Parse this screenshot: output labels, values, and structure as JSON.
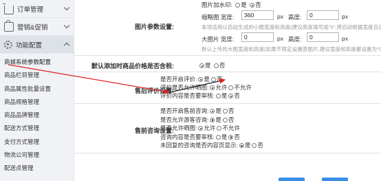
{
  "sidebar": {
    "sections": [
      {
        "label": "订单管理",
        "icon": "cart-icon",
        "state": "collapsed"
      },
      {
        "label": "营销&促销",
        "icon": "shop-icon",
        "state": "collapsed"
      },
      {
        "label": "功能配置",
        "icon": "gear-icon",
        "state": "expanded"
      }
    ],
    "items": [
      "商城系统参数配置",
      "商品栏目管理",
      "商品属性批量设置",
      "商品规格管理",
      "商品品牌管理",
      "配送方式管理",
      "支付方式管理",
      "物流公司管理",
      "配送点管理"
    ]
  },
  "settings": {
    "image_params": {
      "label": "图片参数设置:",
      "watermark_label": "图片加水印:",
      "watermark_yes": "是",
      "watermark_no": "否",
      "thumb_label": "缩略图 宽度:",
      "thumb_width": "360",
      "unit_px": "px",
      "height_label": "高度:",
      "thumb_height": "0",
      "thumb_hint": "本项适用以自动生成的小图宽度和高度(建议高度填写成\"0\",将自动根据宽度自适应。)",
      "large_label": "大图片 宽度:",
      "large_width": "0",
      "large_height": "0",
      "large_hint": "默认上传的大图宽度和高度(如果不限定设置原图片,建议宽度和高度都设置为\"0\")"
    },
    "price_tax": {
      "label": "默认添加时商品价格是否含税:",
      "yes": "是",
      "no": "否"
    },
    "after_sales": {
      "label": "售后评价设置:",
      "lines": [
        {
          "label": "是否开启评价:",
          "a": "是",
          "b": "否",
          "selected": "a"
        },
        {
          "label": "评价是否允许晒图:",
          "a": "允许",
          "b": "不允许",
          "selected": "a"
        },
        {
          "label": "评价内容是否要审核:",
          "a": "是",
          "b": "否",
          "selected": "b"
        }
      ]
    },
    "pre_sales": {
      "label": "售前咨询设置:",
      "lines": [
        {
          "label": "是否开启售前咨询:",
          "a": "是",
          "b": "否",
          "selected": "a"
        },
        {
          "label": "是否允许游客咨询:",
          "a": "是",
          "b": "否",
          "selected": "a"
        },
        {
          "label": "是否允许晒图:",
          "a": "允许",
          "b": "不允许",
          "selected": "a"
        },
        {
          "label": "咨询内容是否要审核:",
          "a": "是",
          "b": "否",
          "selected": "b"
        },
        {
          "label": "未回复的咨询是否内容页显示:",
          "a": "是",
          "b": "否",
          "selected": "a"
        }
      ]
    }
  },
  "colors": {
    "annotation_arrow": "#e02020",
    "sidebar_bg": "#f0f2f5",
    "button": "#3a8ee6"
  }
}
